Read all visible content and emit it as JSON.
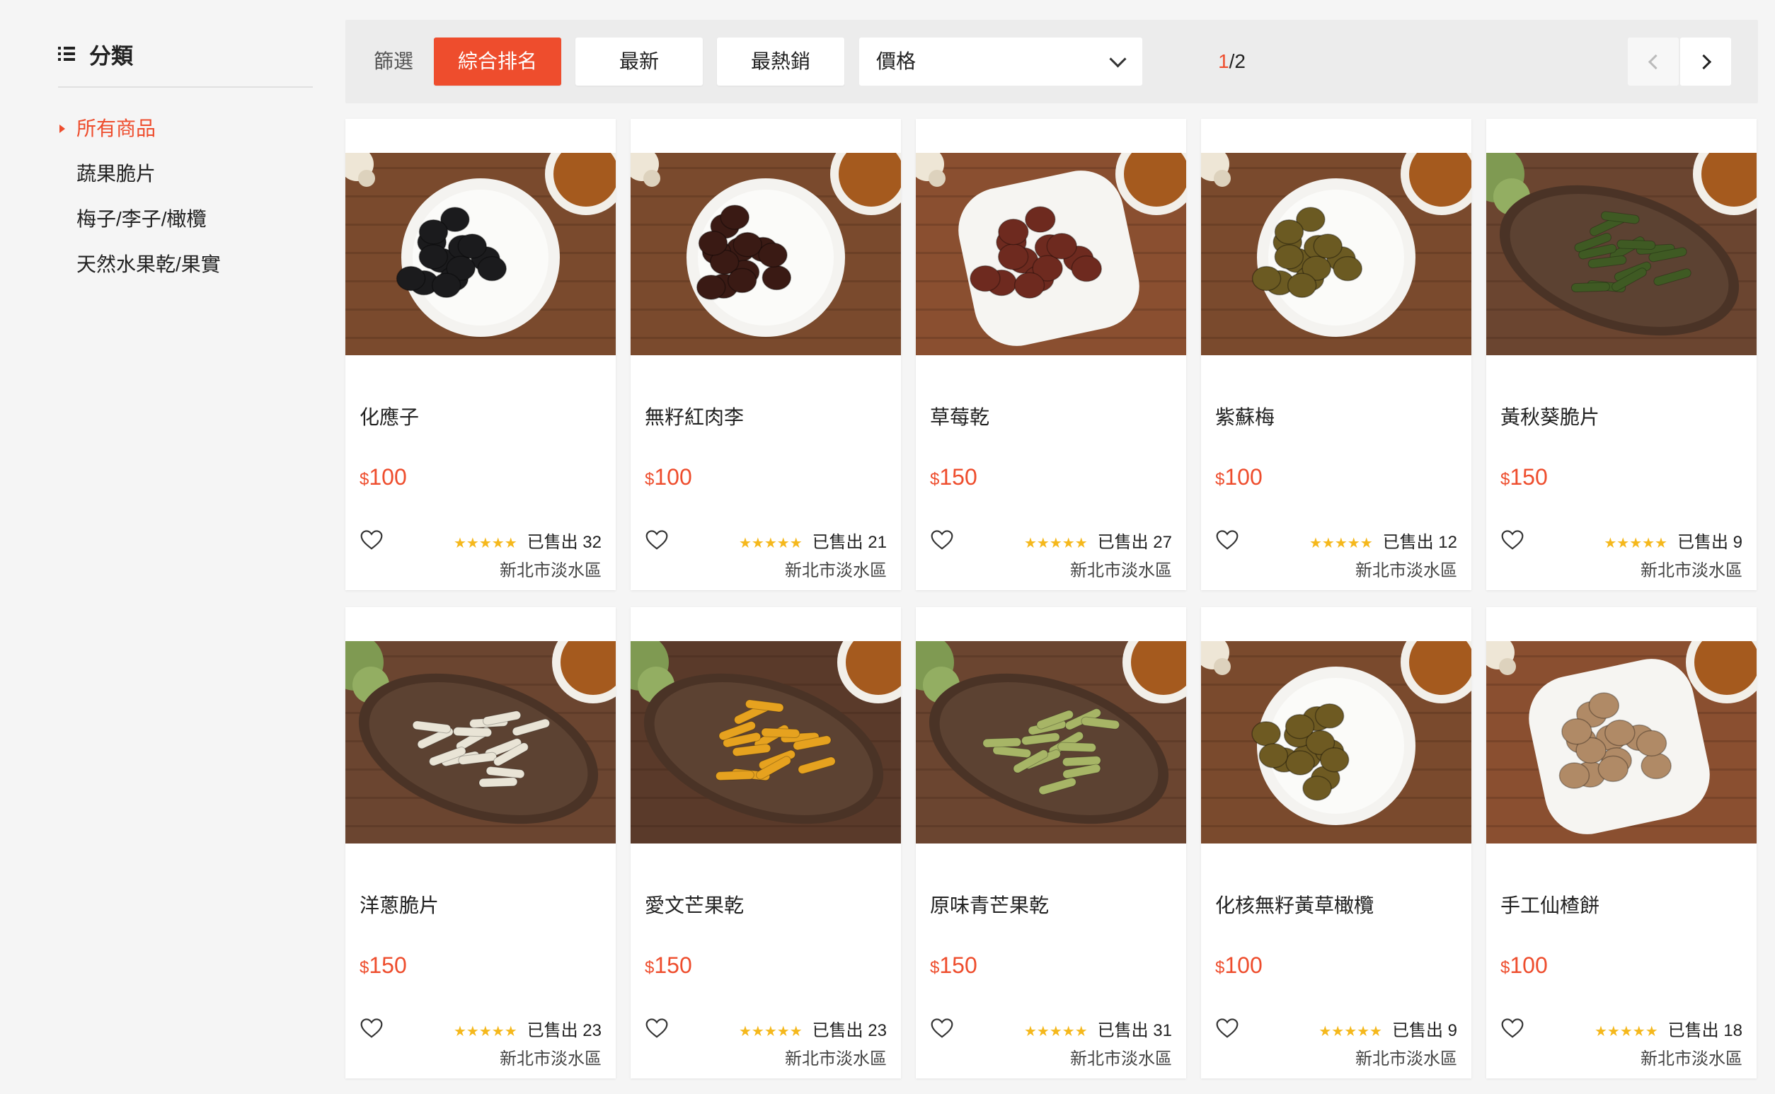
{
  "sidebar": {
    "title": "分類",
    "categories": [
      {
        "label": "所有商品",
        "active": true
      },
      {
        "label": "蔬果脆片",
        "active": false
      },
      {
        "label": "梅子/李子/橄欖",
        "active": false
      },
      {
        "label": "天然水果乾/果實",
        "active": false
      }
    ]
  },
  "filter": {
    "label": "篩選",
    "sort_options": [
      "綜合排名",
      "最新",
      "最熱銷"
    ],
    "active_sort": "綜合排名",
    "price_select": "價格",
    "page_current": "1",
    "page_total": "/2"
  },
  "colors": {
    "accent": "#ee4d2d",
    "star": "#f5b81c"
  },
  "products": [
    {
      "name": "化應子",
      "currency": "$",
      "price": "100",
      "stars": "★★★★★",
      "sold": "已售出 32",
      "location": "新北市淡水區",
      "food_color": "#1b1b1d",
      "plate": "round",
      "table": "#7a4a2d"
    },
    {
      "name": "無籽紅肉李",
      "currency": "$",
      "price": "100",
      "stars": "★★★★★",
      "sold": "已售出 21",
      "location": "新北市淡水區",
      "food_color": "#3a1a14",
      "plate": "round",
      "table": "#7a4a2d"
    },
    {
      "name": "草莓乾",
      "currency": "$",
      "price": "150",
      "stars": "★★★★★",
      "sold": "已售出 27",
      "location": "新北市淡水區",
      "food_color": "#6e2a1f",
      "plate": "square",
      "table": "#8a4f30"
    },
    {
      "name": "紫蘇梅",
      "currency": "$",
      "price": "100",
      "stars": "★★★★★",
      "sold": "已售出 12",
      "location": "新北市淡水區",
      "food_color": "#6b5a22",
      "plate": "round",
      "table": "#7a4a2d"
    },
    {
      "name": "黃秋葵脆片",
      "currency": "$",
      "price": "150",
      "stars": "★★★★★",
      "sold": "已售出 9",
      "location": "新北市淡水區",
      "food_color": "#3f5a23",
      "plate": "oval",
      "table": "#6b4530"
    },
    {
      "name": "洋蔥脆片",
      "currency": "$",
      "price": "150",
      "stars": "★★★★★",
      "sold": "已售出 23",
      "location": "新北市淡水區",
      "food_color": "#e9e4d6",
      "plate": "oval",
      "table": "#6b4530"
    },
    {
      "name": "愛文芒果乾",
      "currency": "$",
      "price": "150",
      "stars": "★★★★★",
      "sold": "已售出 23",
      "location": "新北市淡水區",
      "food_color": "#e6a21f",
      "plate": "oval",
      "table": "#5a3a2a"
    },
    {
      "name": "原味青芒果乾",
      "currency": "$",
      "price": "150",
      "stars": "★★★★★",
      "sold": "已售出 31",
      "location": "新北市淡水區",
      "food_color": "#a7b566",
      "plate": "oval",
      "table": "#6b4530"
    },
    {
      "name": "化核無籽黃草橄欖",
      "currency": "$",
      "price": "100",
      "stars": "★★★★★",
      "sold": "已售出 9",
      "location": "新北市淡水區",
      "food_color": "#6e5a22",
      "plate": "round",
      "table": "#7a4a2d"
    },
    {
      "name": "手工仙楂餅",
      "currency": "$",
      "price": "100",
      "stars": "★★★★★",
      "sold": "已售出 18",
      "location": "新北市淡水區",
      "food_color": "#b08a66",
      "plate": "square",
      "table": "#8a4f30"
    }
  ]
}
